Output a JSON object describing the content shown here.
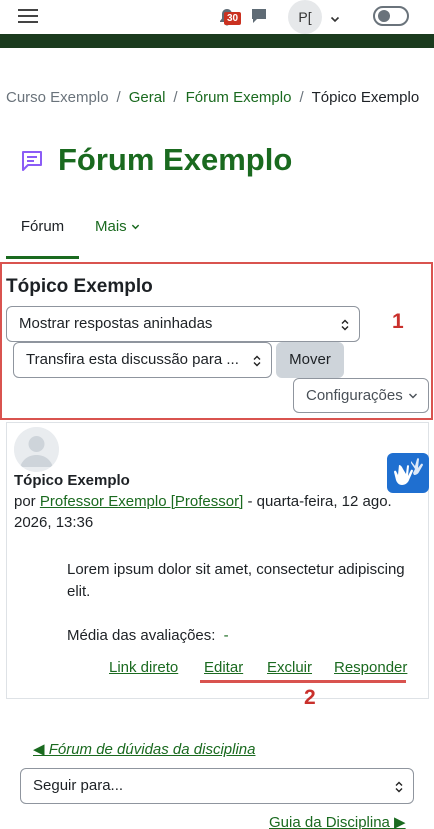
{
  "navbar": {
    "notification_count": "30",
    "user_initials": "P["
  },
  "breadcrumb": {
    "items": [
      "Curso Exemplo",
      "Geral",
      "Fórum Exemplo",
      "Tópico Exemplo"
    ]
  },
  "page": {
    "title": "Fórum Exemplo"
  },
  "tabs": {
    "forum": "Fórum",
    "more": "Mais"
  },
  "discussion": {
    "title": "Tópico Exemplo",
    "display_mode": "Mostrar respostas aninhadas",
    "move_select": "Transfira esta discussão para ...",
    "move_button": "Mover",
    "settings_button": "Configurações"
  },
  "annotations": {
    "marker_1": "1",
    "marker_2": "2"
  },
  "post": {
    "subject": "Tópico Exemplo",
    "by_prefix": "por",
    "author": "Professor Exemplo [Professor]",
    "date": " - quarta-feira, 12 ago. 2026, 13:36",
    "body": "Lorem ipsum dolor sit amet, consectetur adipiscing elit.",
    "rating_label": "Média das avaliações:",
    "rating_value": "-",
    "actions": {
      "permalink": "Link direto",
      "edit": "Editar",
      "delete": "Excluir",
      "reply": "Responder"
    }
  },
  "footer_nav": {
    "previous": "◀ Fórum de dúvidas da disciplina",
    "jump_placeholder": "Seguir para...",
    "next": "Guia da Disciplina ▶"
  },
  "colors": {
    "brand_green": "#1a6a1f",
    "header_bar": "#1b3b1e",
    "annotation_red": "#d9534f",
    "badge_red": "#ca3120",
    "vlibras_blue": "#1f6fd0"
  },
  "icons": [
    "menu-icon",
    "bell-icon",
    "chat-icon",
    "chevron-down-icon",
    "dark-mode-toggle",
    "forum-icon",
    "user-avatar-icon",
    "vlibras-hands-icon"
  ]
}
